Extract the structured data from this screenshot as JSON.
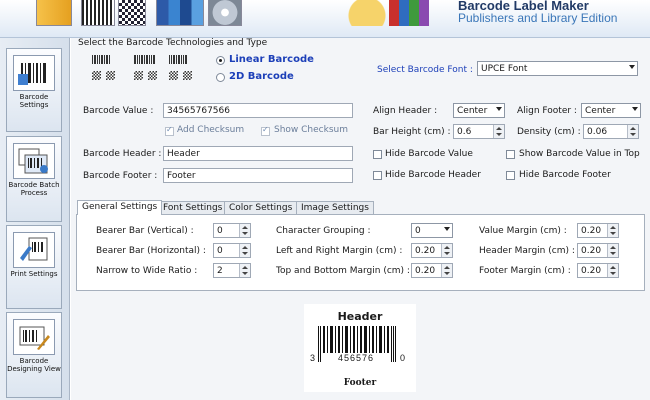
{
  "header": {
    "title": "Barcode Label Maker",
    "subtitle": "Publishers and Library Edition"
  },
  "sidebar": {
    "items": [
      {
        "label": "Barcode Settings",
        "icon": "barcode-settings-icon"
      },
      {
        "label": "Barcode Batch Process",
        "icon": "batch-process-icon"
      },
      {
        "label": "Print Settings",
        "icon": "print-settings-icon"
      },
      {
        "label": "Barcode Designing View",
        "icon": "designing-view-icon"
      }
    ]
  },
  "tech": {
    "title": "Select the Barcode Technologies and Type",
    "linear": "Linear Barcode",
    "twod": "2D Barcode",
    "font_label": "Select Barcode Font :",
    "font_value": "UPCE Font"
  },
  "form": {
    "value_label": "Barcode Value :",
    "value": "34565767566",
    "add_checksum": "Add Checksum",
    "show_checksum": "Show Checksum",
    "header_label": "Barcode Header :",
    "header_value": "Header",
    "footer_label": "Barcode Footer :",
    "footer_value": "Footer",
    "align_header_label": "Align Header :",
    "align_header": "Center",
    "align_footer_label": "Align Footer :",
    "align_footer": "Center",
    "bar_height_label": "Bar Height (cm) :",
    "bar_height": "0.6",
    "density_label": "Density (cm) :",
    "density": "0.06",
    "hide_value": "Hide Barcode Value",
    "show_value_top": "Show Barcode Value in Top",
    "hide_header": "Hide Barcode Header",
    "hide_footer": "Hide Barcode Footer"
  },
  "tabs": [
    "General Settings",
    "Font Settings",
    "Color Settings",
    "Image Settings"
  ],
  "general": {
    "bearer_v_label": "Bearer Bar (Vertical) :",
    "bearer_v": "0",
    "bearer_h_label": "Bearer Bar (Horizontal) :",
    "bearer_h": "0",
    "ratio_label": "Narrow to Wide Ratio :",
    "ratio": "2",
    "grouping_label": "Character Grouping :",
    "grouping": "0",
    "lr_margin_label": "Left and Right Margin (cm) :",
    "lr_margin": "0.20",
    "tb_margin_label": "Top and Bottom Margin (cm) :",
    "tb_margin": "0.20",
    "value_margin_label": "Value Margin (cm) :",
    "value_margin": "0.20",
    "header_margin_label": "Header Margin (cm) :",
    "header_margin": "0.20",
    "footer_margin_label": "Footer Margin (cm) :",
    "footer_margin": "0.20"
  },
  "preview": {
    "header": "Header",
    "footer": "Footer",
    "left_digit": "3",
    "middle_digits": "456576",
    "right_digit": "0"
  }
}
